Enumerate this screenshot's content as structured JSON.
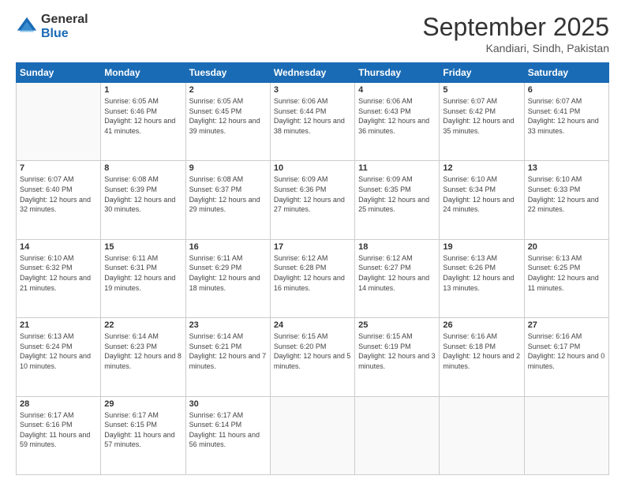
{
  "header": {
    "logo_line1": "General",
    "logo_line2": "Blue",
    "month": "September 2025",
    "location": "Kandiari, Sindh, Pakistan"
  },
  "days_of_week": [
    "Sunday",
    "Monday",
    "Tuesday",
    "Wednesday",
    "Thursday",
    "Friday",
    "Saturday"
  ],
  "weeks": [
    [
      {
        "day": "",
        "sunrise": "",
        "sunset": "",
        "daylight": ""
      },
      {
        "day": "1",
        "sunrise": "Sunrise: 6:05 AM",
        "sunset": "Sunset: 6:46 PM",
        "daylight": "Daylight: 12 hours and 41 minutes."
      },
      {
        "day": "2",
        "sunrise": "Sunrise: 6:05 AM",
        "sunset": "Sunset: 6:45 PM",
        "daylight": "Daylight: 12 hours and 39 minutes."
      },
      {
        "day": "3",
        "sunrise": "Sunrise: 6:06 AM",
        "sunset": "Sunset: 6:44 PM",
        "daylight": "Daylight: 12 hours and 38 minutes."
      },
      {
        "day": "4",
        "sunrise": "Sunrise: 6:06 AM",
        "sunset": "Sunset: 6:43 PM",
        "daylight": "Daylight: 12 hours and 36 minutes."
      },
      {
        "day": "5",
        "sunrise": "Sunrise: 6:07 AM",
        "sunset": "Sunset: 6:42 PM",
        "daylight": "Daylight: 12 hours and 35 minutes."
      },
      {
        "day": "6",
        "sunrise": "Sunrise: 6:07 AM",
        "sunset": "Sunset: 6:41 PM",
        "daylight": "Daylight: 12 hours and 33 minutes."
      }
    ],
    [
      {
        "day": "7",
        "sunrise": "Sunrise: 6:07 AM",
        "sunset": "Sunset: 6:40 PM",
        "daylight": "Daylight: 12 hours and 32 minutes."
      },
      {
        "day": "8",
        "sunrise": "Sunrise: 6:08 AM",
        "sunset": "Sunset: 6:39 PM",
        "daylight": "Daylight: 12 hours and 30 minutes."
      },
      {
        "day": "9",
        "sunrise": "Sunrise: 6:08 AM",
        "sunset": "Sunset: 6:37 PM",
        "daylight": "Daylight: 12 hours and 29 minutes."
      },
      {
        "day": "10",
        "sunrise": "Sunrise: 6:09 AM",
        "sunset": "Sunset: 6:36 PM",
        "daylight": "Daylight: 12 hours and 27 minutes."
      },
      {
        "day": "11",
        "sunrise": "Sunrise: 6:09 AM",
        "sunset": "Sunset: 6:35 PM",
        "daylight": "Daylight: 12 hours and 25 minutes."
      },
      {
        "day": "12",
        "sunrise": "Sunrise: 6:10 AM",
        "sunset": "Sunset: 6:34 PM",
        "daylight": "Daylight: 12 hours and 24 minutes."
      },
      {
        "day": "13",
        "sunrise": "Sunrise: 6:10 AM",
        "sunset": "Sunset: 6:33 PM",
        "daylight": "Daylight: 12 hours and 22 minutes."
      }
    ],
    [
      {
        "day": "14",
        "sunrise": "Sunrise: 6:10 AM",
        "sunset": "Sunset: 6:32 PM",
        "daylight": "Daylight: 12 hours and 21 minutes."
      },
      {
        "day": "15",
        "sunrise": "Sunrise: 6:11 AM",
        "sunset": "Sunset: 6:31 PM",
        "daylight": "Daylight: 12 hours and 19 minutes."
      },
      {
        "day": "16",
        "sunrise": "Sunrise: 6:11 AM",
        "sunset": "Sunset: 6:29 PM",
        "daylight": "Daylight: 12 hours and 18 minutes."
      },
      {
        "day": "17",
        "sunrise": "Sunrise: 6:12 AM",
        "sunset": "Sunset: 6:28 PM",
        "daylight": "Daylight: 12 hours and 16 minutes."
      },
      {
        "day": "18",
        "sunrise": "Sunrise: 6:12 AM",
        "sunset": "Sunset: 6:27 PM",
        "daylight": "Daylight: 12 hours and 14 minutes."
      },
      {
        "day": "19",
        "sunrise": "Sunrise: 6:13 AM",
        "sunset": "Sunset: 6:26 PM",
        "daylight": "Daylight: 12 hours and 13 minutes."
      },
      {
        "day": "20",
        "sunrise": "Sunrise: 6:13 AM",
        "sunset": "Sunset: 6:25 PM",
        "daylight": "Daylight: 12 hours and 11 minutes."
      }
    ],
    [
      {
        "day": "21",
        "sunrise": "Sunrise: 6:13 AM",
        "sunset": "Sunset: 6:24 PM",
        "daylight": "Daylight: 12 hours and 10 minutes."
      },
      {
        "day": "22",
        "sunrise": "Sunrise: 6:14 AM",
        "sunset": "Sunset: 6:23 PM",
        "daylight": "Daylight: 12 hours and 8 minutes."
      },
      {
        "day": "23",
        "sunrise": "Sunrise: 6:14 AM",
        "sunset": "Sunset: 6:21 PM",
        "daylight": "Daylight: 12 hours and 7 minutes."
      },
      {
        "day": "24",
        "sunrise": "Sunrise: 6:15 AM",
        "sunset": "Sunset: 6:20 PM",
        "daylight": "Daylight: 12 hours and 5 minutes."
      },
      {
        "day": "25",
        "sunrise": "Sunrise: 6:15 AM",
        "sunset": "Sunset: 6:19 PM",
        "daylight": "Daylight: 12 hours and 3 minutes."
      },
      {
        "day": "26",
        "sunrise": "Sunrise: 6:16 AM",
        "sunset": "Sunset: 6:18 PM",
        "daylight": "Daylight: 12 hours and 2 minutes."
      },
      {
        "day": "27",
        "sunrise": "Sunrise: 6:16 AM",
        "sunset": "Sunset: 6:17 PM",
        "daylight": "Daylight: 12 hours and 0 minutes."
      }
    ],
    [
      {
        "day": "28",
        "sunrise": "Sunrise: 6:17 AM",
        "sunset": "Sunset: 6:16 PM",
        "daylight": "Daylight: 11 hours and 59 minutes."
      },
      {
        "day": "29",
        "sunrise": "Sunrise: 6:17 AM",
        "sunset": "Sunset: 6:15 PM",
        "daylight": "Daylight: 11 hours and 57 minutes."
      },
      {
        "day": "30",
        "sunrise": "Sunrise: 6:17 AM",
        "sunset": "Sunset: 6:14 PM",
        "daylight": "Daylight: 11 hours and 56 minutes."
      },
      {
        "day": "",
        "sunrise": "",
        "sunset": "",
        "daylight": ""
      },
      {
        "day": "",
        "sunrise": "",
        "sunset": "",
        "daylight": ""
      },
      {
        "day": "",
        "sunrise": "",
        "sunset": "",
        "daylight": ""
      },
      {
        "day": "",
        "sunrise": "",
        "sunset": "",
        "daylight": ""
      }
    ]
  ]
}
